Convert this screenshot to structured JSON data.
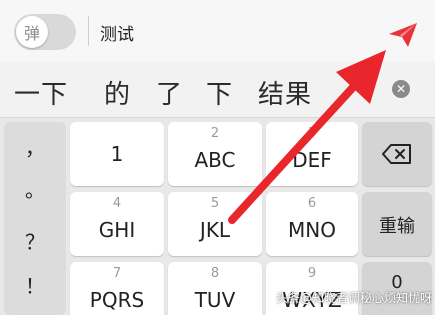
{
  "topbar": {
    "toggle_label": "弹",
    "title": "测试"
  },
  "candidates": [
    "一下",
    "的",
    "了",
    "下",
    "结果"
  ],
  "punctuation": [
    "，",
    "。",
    "？",
    "！"
  ],
  "keys": [
    {
      "num": "",
      "label": "1"
    },
    {
      "num": "2",
      "label": "ABC"
    },
    {
      "num": "3",
      "label": "DEF"
    },
    {
      "num": "4",
      "label": "GHI"
    },
    {
      "num": "5",
      "label": "JKL"
    },
    {
      "num": "6",
      "label": "MNO"
    },
    {
      "num": "7",
      "label": "PQRS"
    },
    {
      "num": "8",
      "label": "TUV"
    },
    {
      "num": "9",
      "label": "WXYZ"
    }
  ],
  "function_keys": {
    "backspace_icon": "backspace-icon",
    "retype": "重输",
    "zero": "0"
  },
  "watermark": "头条@知晓者调秘心烦知忧呀",
  "colors": {
    "accent": "#e8323c",
    "arrow": "#e8262b"
  }
}
